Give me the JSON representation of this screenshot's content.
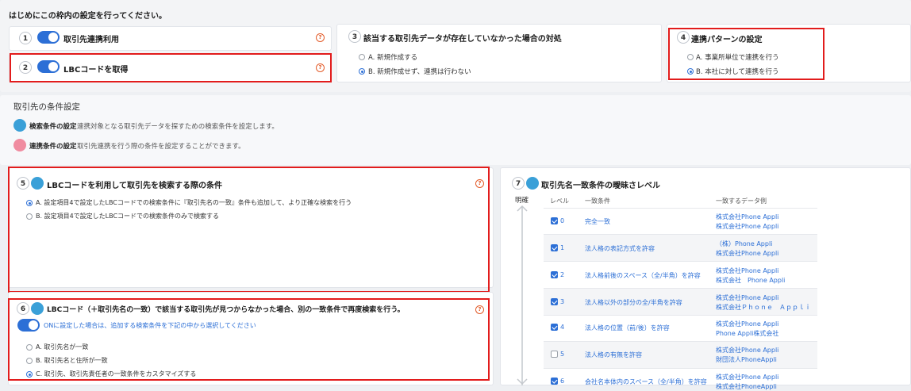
{
  "top": {
    "header": "はじめにこの枠内の設定を行ってください。",
    "item1": {
      "num": "1",
      "label": "取引先連携利用"
    },
    "item2": {
      "num": "2",
      "label": "LBCコードを取得"
    },
    "item3": {
      "num": "3",
      "label": "該当する取引先データが存在していなかった場合の対処",
      "options": [
        "A. 新規作成する",
        "B. 新規作成せず、連携は行わない"
      ],
      "selected": 1
    },
    "item4": {
      "num": "4",
      "label": "連携パターンの設定",
      "options": [
        "A. 事業所単位で連携を行う",
        "B. 本社に対して連携を行う"
      ],
      "selected": 1
    },
    "help": "?"
  },
  "conditions": {
    "title": "取引先の条件設定",
    "search_label": "検索条件の設定",
    "search_desc": "連携対象となる取引先データを探すための検索条件を設定します。",
    "link_label": "連携条件の設定",
    "link_desc": "取引先連携を行う際の条件を設定することができます。"
  },
  "item5": {
    "num": "5",
    "label": "LBCコードを利用して取引先を検索する際の条件",
    "options": [
      "A. 設定項目4で設定したLBCコードでの検索条件に『取引先名の一致』条件も追加して、より正確な検索を行う",
      "B. 設定項目4で設定したLBCコードでの検索条件のみで検索する"
    ],
    "selected": 0
  },
  "item6": {
    "num": "6",
    "label": "LBCコード（＋取引先名の一致）で該当する取引先が見つからなかった場合、別の一致条件で再度検索を行う。",
    "toggle_desc": "ONに設定した場合は、追加する検索条件を下記の中から選択してください",
    "options": [
      "A. 取引先名が一致",
      "B. 取引先名と住所が一致",
      "C. 取引先、取引先責任者の一致条件をカスタマイズする"
    ],
    "selected": 2
  },
  "item7": {
    "num": "7",
    "label": "取引先名一致条件の曖昧さレベル",
    "axis_top": "明確",
    "headers": [
      "レベル",
      "一致条件",
      "一致するデータ例"
    ],
    "rows": [
      {
        "level": "0",
        "checked": true,
        "condition": "完全一致",
        "ex1": "株式会社Phone Appli",
        "ex2": "株式会社Phone Appli"
      },
      {
        "level": "1",
        "checked": true,
        "condition": "法人格の表記方式を許容",
        "ex1": "（株）Phone Appli",
        "ex2": "株式会社Phone Appli"
      },
      {
        "level": "2",
        "checked": true,
        "condition": "法人格前後のスペース（全/半角）を許容",
        "ex1": "株式会社Phone Appli",
        "ex2": "株式会社　Phone Appli"
      },
      {
        "level": "3",
        "checked": true,
        "condition": "法人格以外の部分の全/半角を許容",
        "ex1": "株式会社Phone Appli",
        "ex2": "株式会社Ｐｈｏｎｅ　Ａｐｐｌｉ"
      },
      {
        "level": "4",
        "checked": true,
        "condition": "法人格の位置（前/後）を許容",
        "ex1": "株式会社Phone Appli",
        "ex2": "Phone Appli株式会社"
      },
      {
        "level": "5",
        "checked": false,
        "condition": "法人格の有無を許容",
        "ex1": "株式会社Phone Appli",
        "ex2": "財団法人PhoneAppli"
      },
      {
        "level": "6",
        "checked": true,
        "condition": "会社名本体内のスペース（全/半角）を許容",
        "ex1": "株式会社Phone Appli",
        "ex2": "株式会社PhoneAppli"
      }
    ]
  }
}
